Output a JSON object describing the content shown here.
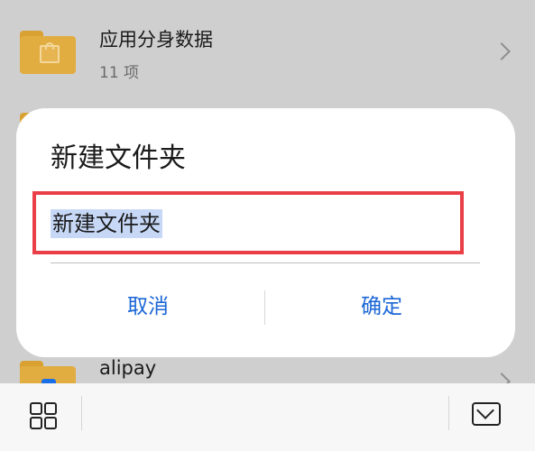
{
  "list": {
    "item1": {
      "title": "应用分身数据",
      "subtitle": "11 项"
    },
    "item2": {
      "title": "alipay"
    }
  },
  "dialog": {
    "title": "新建文件夹",
    "input_value": "新建文件夹",
    "cancel_label": "取消",
    "confirm_label": "确定"
  },
  "bottom_bar": {
    "left_icon": "grid-view-icon",
    "right_icon": "mail-icon"
  },
  "colors": {
    "accent": "#1a66d6",
    "highlight_border": "#ea3f47",
    "selection": "#c7d8f7",
    "folder": "#e2ad40"
  }
}
